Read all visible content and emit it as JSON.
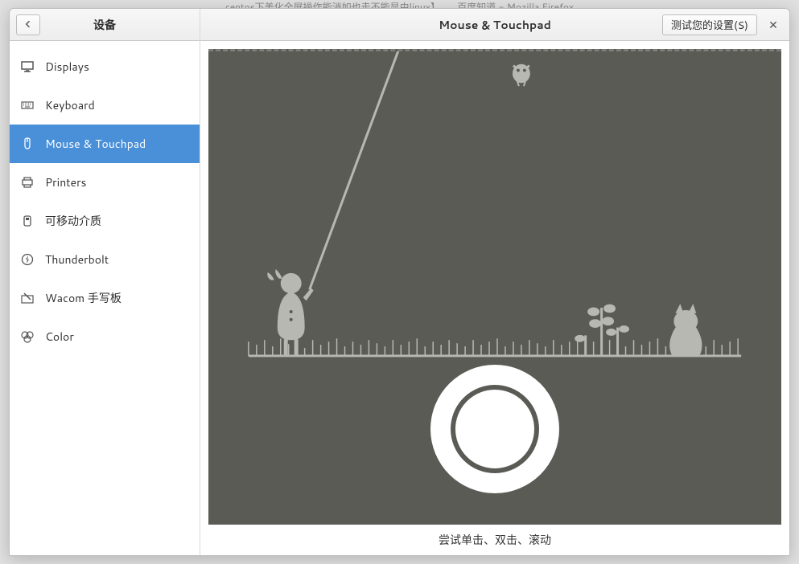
{
  "background": {
    "title_fragment": "centos下美化全屏操作能消如也走不能显由linux】。。。 百度知道 - Mozilla Firefox"
  },
  "sidebar": {
    "title": "设备",
    "items": [
      {
        "label": "Displays",
        "icon": "display"
      },
      {
        "label": "Keyboard",
        "icon": "keyboard"
      },
      {
        "label": "Mouse & Touchpad",
        "icon": "mouse",
        "active": true
      },
      {
        "label": "Printers",
        "icon": "printer"
      },
      {
        "label": "可移动介质",
        "icon": "removable"
      },
      {
        "label": "Thunderbolt",
        "icon": "thunderbolt"
      },
      {
        "label": "Wacom 手写板",
        "icon": "wacom"
      },
      {
        "label": "Color",
        "icon": "color"
      }
    ]
  },
  "header": {
    "title": "Mouse & Touchpad",
    "test_button": "测试您的设置(S)"
  },
  "footer": {
    "hint": "尝试单击、双击、滚动"
  }
}
